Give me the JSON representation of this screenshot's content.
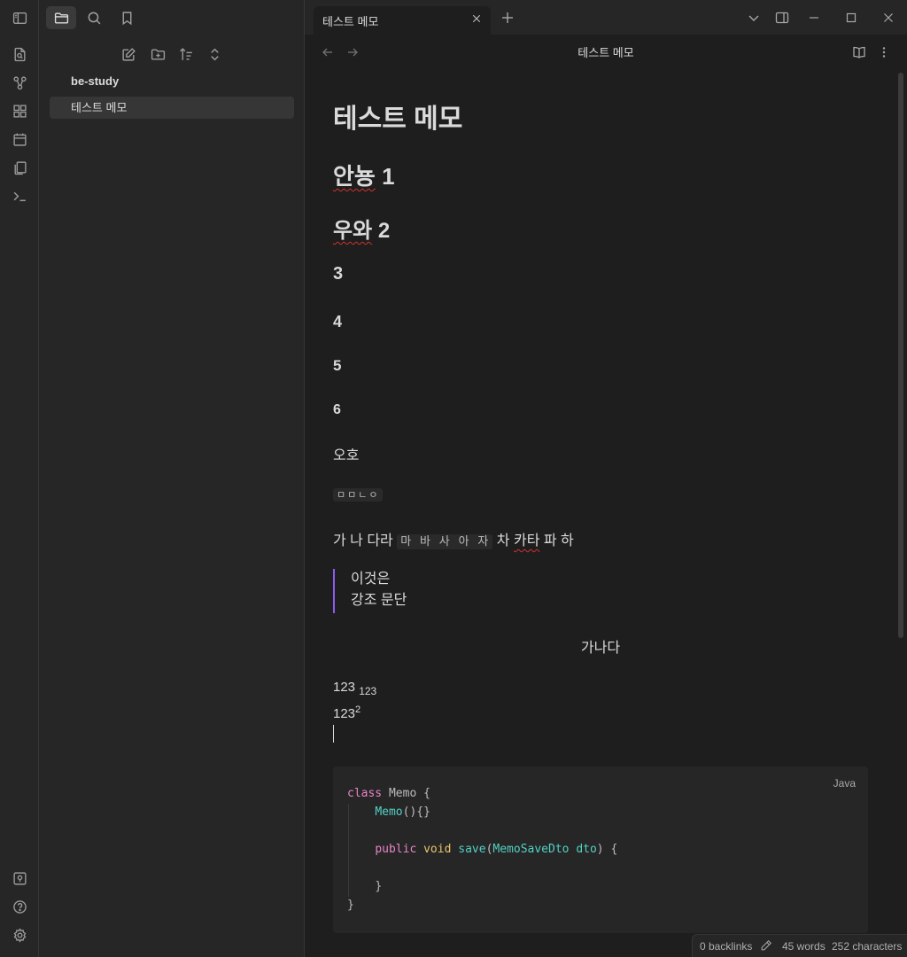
{
  "window": {
    "tab_title": "테스트 메모"
  },
  "sidebar": {
    "folder": "be-study",
    "files": [
      "테스트 메모"
    ]
  },
  "view": {
    "title": "테스트 메모"
  },
  "note": {
    "title": "테스트 메모",
    "h2_word": "안뇽",
    "h2_num": "1",
    "h3_word": "우와",
    "h3_num": "2",
    "h4": "3",
    "h5": "4",
    "h6a": "5",
    "h6b": "6",
    "para1": "오호",
    "inline1": "ㅁㅁㄴㅇ",
    "line_a": "가 나 다라",
    "line_code": "마 바 사 아 자",
    "line_b1": "차",
    "line_b2": "카타",
    "line_b3": "파 하",
    "quote_line1": "이것은",
    "quote_line2": "강조 문단",
    "centered": "가나다",
    "sub_base": "123",
    "sub_text": "123",
    "sup_base": "123",
    "sup_text": "2",
    "code_lang": "Java",
    "code": {
      "l1_kw": "class",
      "l1_rest": " Memo {",
      "l2_fn": "Memo",
      "l2_rest": "(){}",
      "l4_kw1": "public",
      "l4_kw2": "void",
      "l4_fn": "save",
      "l4_type": "MemoSaveDto",
      "l4_param": "dto",
      "l6": "}",
      "l7": "}"
    }
  },
  "status": {
    "backlinks": "0 backlinks",
    "words": "45 words",
    "characters": "252 characters"
  }
}
